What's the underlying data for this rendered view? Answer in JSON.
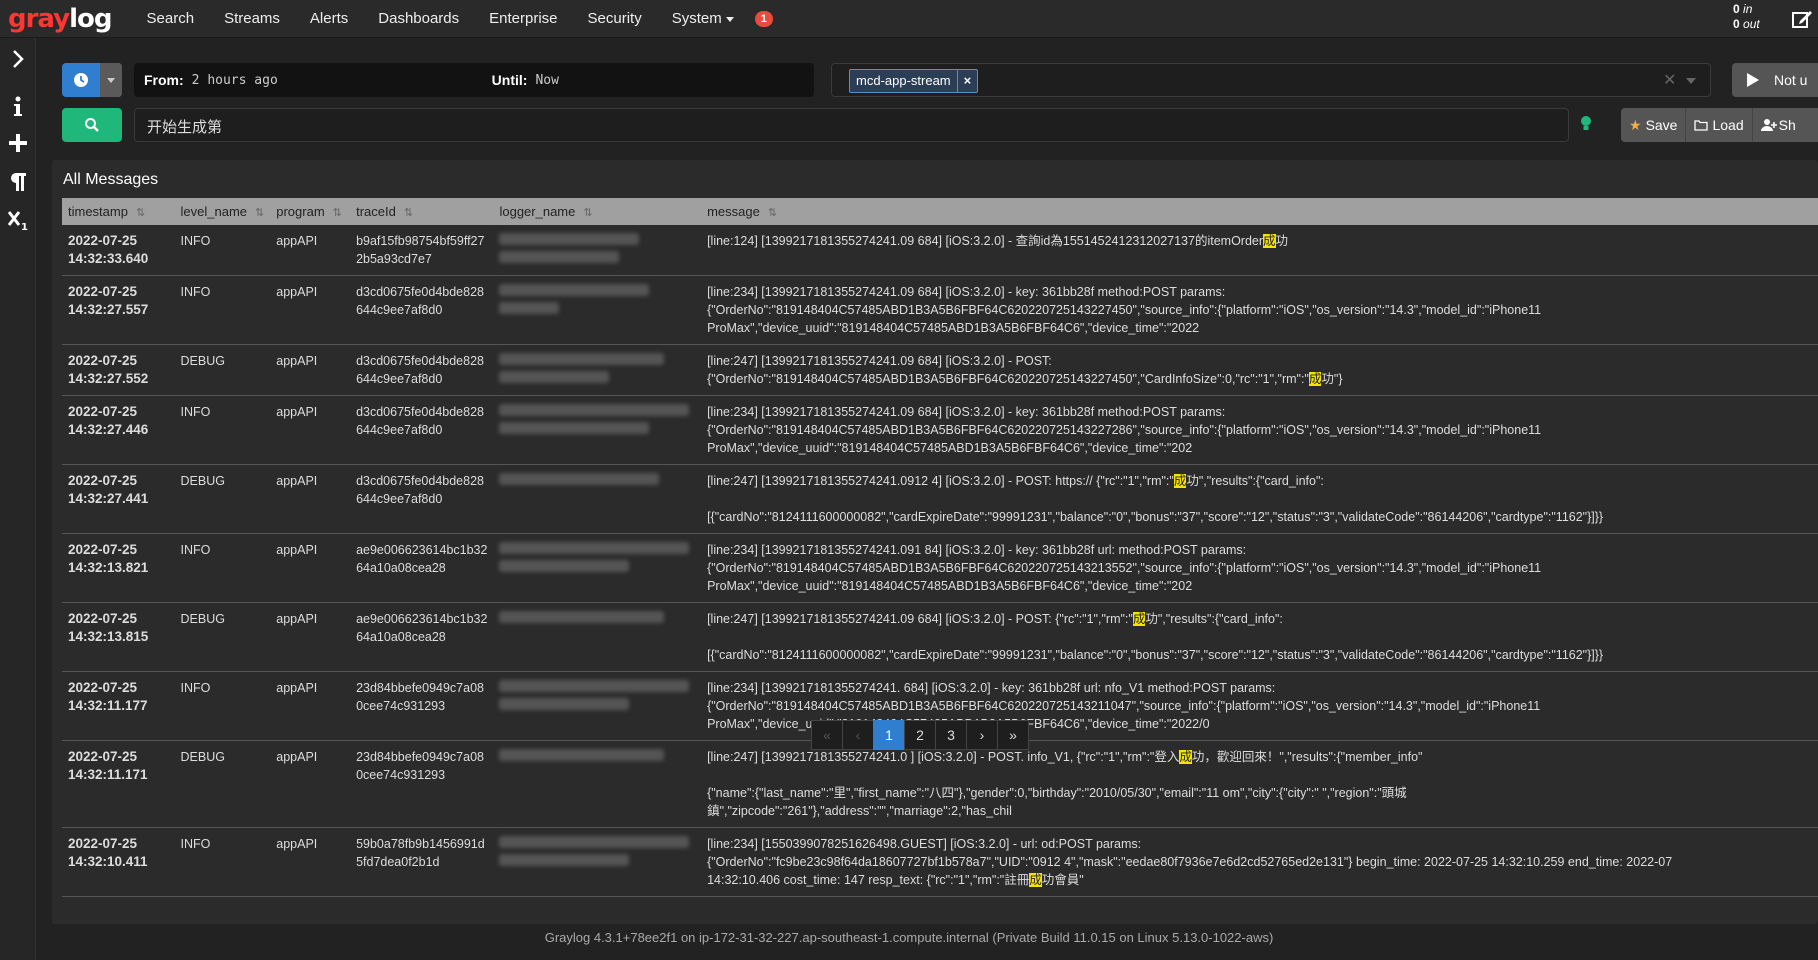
{
  "nav": {
    "items": [
      "Search",
      "Streams",
      "Alerts",
      "Dashboards",
      "Enterprise",
      "Security"
    ],
    "system": "System",
    "notifications": "1",
    "throughput_in": "0",
    "throughput_in_label": "in",
    "throughput_out": "0",
    "throughput_out_label": "out"
  },
  "timerange": {
    "from_label": "From:",
    "from_value": "2 hours ago",
    "until_label": "Until:",
    "until_value": "Now"
  },
  "stream": {
    "selected": "mcd-app-stream"
  },
  "refresh_label": "Not u",
  "query": "开始生成第",
  "actions": {
    "save": "Save",
    "load": "Load",
    "share": "Sh"
  },
  "messages": {
    "title": "All Messages",
    "columns": [
      "timestamp",
      "level_name",
      "program",
      "traceId",
      "logger_name",
      "message"
    ],
    "rows": [
      {
        "date": "2022-07-25",
        "time": "14:32:33.640",
        "level": "INFO",
        "program": "appAPI",
        "trace1": "b9af15fb98754bf59ff27",
        "trace2": "2b5a93cd7e7",
        "msg": [
          "[line:124] [1399217181355274241.09      684] [iOS:3.2.0] - 查詢id為1551452412312027137的itemOrder",
          "成",
          "功"
        ]
      },
      {
        "date": "2022-07-25",
        "time": "14:32:27.557",
        "level": "INFO",
        "program": "appAPI",
        "trace1": "d3cd0675fe0d4bde828",
        "trace2": "644c9ee7af8d0",
        "msg": [
          "[line:234] [1399217181355274241.09      684] [iOS:3.2.0] - key: 361bb28f                                              method:POST params:",
          "{\"OrderNo\":\"819148404C57485ABD1B3A5B6FBF64C620220725143227450\",\"source_info\":{\"platform\":\"iOS\",\"os_version\":\"14.3\",\"model_id\":\"iPhone11",
          "ProMax\",\"device_uuid\":\"819148404C57485ABD1B3A5B6FBF64C6\",\"device_time\":\"2022"
        ]
      },
      {
        "date": "2022-07-25",
        "time": "14:32:27.552",
        "level": "DEBUG",
        "program": "appAPI",
        "trace1": "d3cd0675fe0d4bde828",
        "trace2": "644c9ee7af8d0",
        "msg": [
          "[line:247] [1399217181355274241.09      684] [iOS:3.2.0] - POST:",
          "{\"OrderNo\":\"819148404C57485ABD1B3A5B6FBF64C620220725143227450\",\"CardInfoSize\":0,\"rc\":\"1\",\"rm\":\"",
          "成",
          "功\"}"
        ]
      },
      {
        "date": "2022-07-25",
        "time": "14:32:27.446",
        "level": "INFO",
        "program": "appAPI",
        "trace1": "d3cd0675fe0d4bde828",
        "trace2": "644c9ee7af8d0",
        "msg": [
          "[line:234] [1399217181355274241.09      684] [iOS:3.2.0] - key: 361bb28f                                              method:POST params:",
          "{\"OrderNo\":\"819148404C57485ABD1B3A5B6FBF64C620220725143227286\",\"source_info\":{\"platform\":\"iOS\",\"os_version\":\"14.3\",\"model_id\":\"iPhone11",
          "ProMax\",\"device_uuid\":\"819148404C57485ABD1B3A5B6FBF64C6\",\"device_time\":\"202"
        ]
      },
      {
        "date": "2022-07-25",
        "time": "14:32:27.441",
        "level": "DEBUG",
        "program": "appAPI",
        "trace1": "d3cd0675fe0d4bde828",
        "trace2": "644c9ee7af8d0",
        "msg": [
          "[line:247] [1399217181355274241.0912    4] [iOS:3.2.0] - POST: https://                                   {\"rc\":\"1\",\"rm\":\"",
          "成",
          "功\",\"results\":{\"card_info\":",
          "[{\"cardNo\":\"8124111600000082\",\"cardExpireDate\":\"99991231\",\"balance\":\"0\",\"bonus\":\"37\",\"score\":\"12\",\"status\":\"3\",\"validateCode\":\"86144206\",\"cardtype\":\"1162\"}]}}"
        ]
      },
      {
        "date": "2022-07-25",
        "time": "14:32:13.821",
        "level": "INFO",
        "program": "appAPI",
        "trace1": "ae9e006623614bc1b32",
        "trace2": "64a10a08cea28",
        "msg": [
          "[line:234] [1399217181355274241.091    84] [iOS:3.2.0] - key: 361bb28f url:                                          method:POST params:",
          "{\"OrderNo\":\"819148404C57485ABD1B3A5B6FBF64C620220725143213552\",\"source_info\":{\"platform\":\"iOS\",\"os_version\":\"14.3\",\"model_id\":\"iPhone11",
          "ProMax\",\"device_uuid\":\"819148404C57485ABD1B3A5B6FBF64C6\",\"device_time\":\"202"
        ]
      },
      {
        "date": "2022-07-25",
        "time": "14:32:13.815",
        "level": "DEBUG",
        "program": "appAPI",
        "trace1": "ae9e006623614bc1b32",
        "trace2": "64a10a08cea28",
        "msg": [
          "[line:247] [1399217181355274241.09      684] [iOS:3.2.0] - POST:                                          {\"rc\":\"1\",\"rm\":\"",
          "成",
          "功\",\"results\":{\"card_info\":",
          "[{\"cardNo\":\"8124111600000082\",\"cardExpireDate\":\"99991231\",\"balance\":\"0\",\"bonus\":\"37\",\"score\":\"12\",\"status\":\"3\",\"validateCode\":\"86144206\",\"cardtype\":\"1162\"}]}}"
        ]
      },
      {
        "date": "2022-07-25",
        "time": "14:32:11.177",
        "level": "INFO",
        "program": "appAPI",
        "trace1": "23d84bbefe0949c7a08",
        "trace2": "0cee74c931293",
        "msg": [
          "[line:234] [1399217181355274241.        684] [iOS:3.2.0] - key: 361bb28f url:                              nfo_V1 method:POST params:",
          "{\"OrderNo\":\"819148404C57485ABD1B3A5B6FBF64C620220725143211047\",\"source_info\":{\"platform\":\"iOS\",\"os_version\":\"14.3\",\"model_id\":\"iPhone11",
          "ProMax\",\"device_uuid\":\"819148404C57485ABD1B3A5B6FBF64C6\",\"device_time\":\"2022/0"
        ]
      },
      {
        "date": "2022-07-25",
        "time": "14:32:11.171",
        "level": "DEBUG",
        "program": "appAPI",
        "trace1": "23d84bbefe0949c7a08",
        "trace2": "0cee74c931293",
        "msg": [
          "[line:247] [1399217181355274241.0         ] [iOS:3.2.0] - POST.                          info_V1, {\"rc\":\"1\",\"rm\":\"登入",
          "成",
          "功，歡迎回來！\",\"results\":{\"member_info\"",
          "{\"name\":{\"last_name\":\"里\",\"first_name\":\"八四\"},\"gender\":0,\"birthday\":\"2010/05/30\",\"email\":\"11            om\",\"city\":{\"city\":\"      \",\"region\":\"頭城",
          "鎮\",\"zipcode\":\"261\"},\"address\":\"\",\"marriage\":2,\"has_chil"
        ]
      },
      {
        "date": "2022-07-25",
        "time": "14:32:10.411",
        "level": "INFO",
        "program": "appAPI",
        "trace1": "59b0a78fb9b1456991d",
        "trace2": "5fd7dea0f2b1d",
        "msg": [
          "[line:234] [1550399078251626498.GUEST] [iOS:3.2.0] - url:                                                    od:POST params:",
          "{\"OrderNo\":\"fc9be23c98f64da18607727bf1b578a7\",\"UID\":\"0912      4\",\"mask\":\"eedae80f7936e7e6d2cd52765ed2e131\"} begin_time: 2022-07-25 14:32:10.259 end_time: 2022-07",
          "14:32:10.406 cost_time: 147 resp_text: {\"rc\":\"1\",\"rm\":\"註冊",
          "成",
          "功會員\""
        ]
      }
    ]
  },
  "pagination": [
    "«",
    "‹",
    "1",
    "2",
    "3",
    "›",
    "»"
  ],
  "footer": "Graylog 4.3.1+78ee2f1 on ip-172-31-32-227.ap-southeast-1.compute.internal (Private Build 11.0.15 on Linux 5.13.0-1022-aws)"
}
